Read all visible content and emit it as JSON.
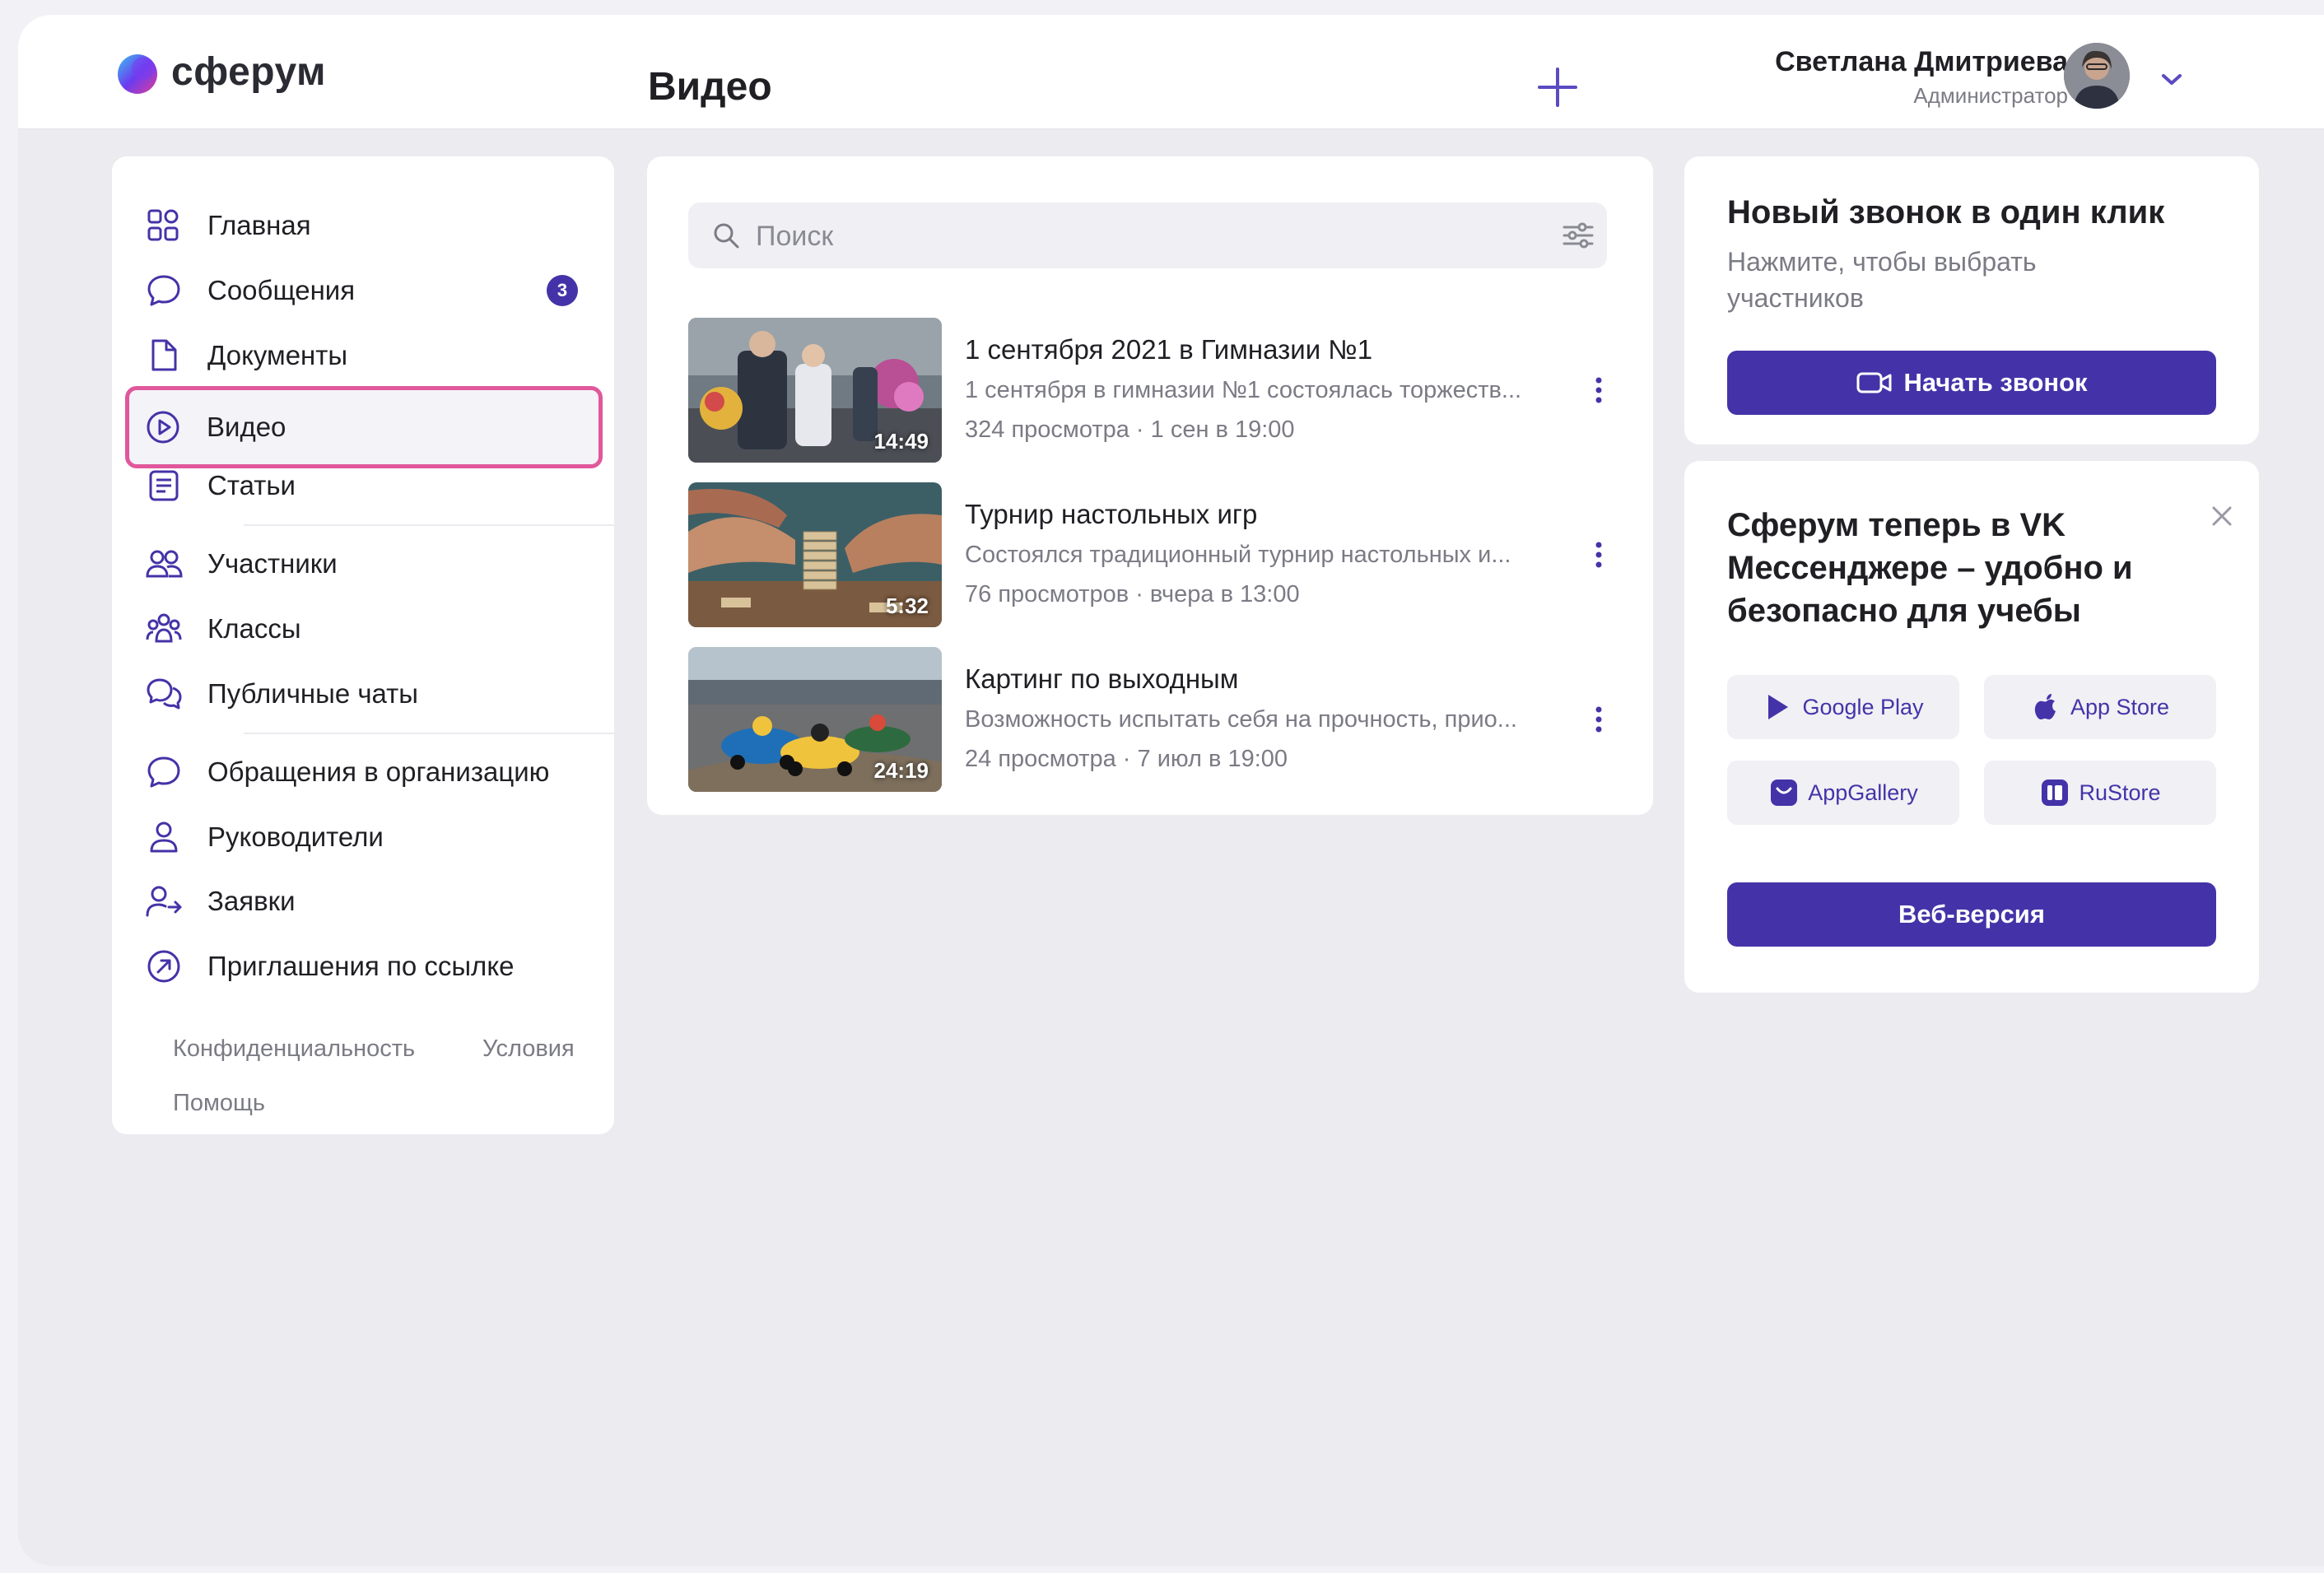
{
  "app": {
    "logo_text": "сферум",
    "page_title": "Видео"
  },
  "user": {
    "name": "Светлана Дмитриева",
    "role": "Администратор"
  },
  "sidebar": {
    "items": [
      {
        "label": "Главная"
      },
      {
        "label": "Сообщения",
        "badge": "3"
      },
      {
        "label": "Документы"
      },
      {
        "label": "Видео",
        "active": true
      },
      {
        "label": "Статьи"
      },
      {
        "label": "Участники"
      },
      {
        "label": "Классы"
      },
      {
        "label": "Публичные чаты"
      },
      {
        "label": "Обращения в организацию"
      },
      {
        "label": "Руководители"
      },
      {
        "label": "Заявки"
      },
      {
        "label": "Приглашения по ссылке"
      }
    ],
    "footer": {
      "privacy": "Конфиденциальность",
      "terms": "Условия",
      "help": "Помощь"
    }
  },
  "search": {
    "placeholder": "Поиск",
    "value": ""
  },
  "videos": [
    {
      "title": "1 сентября 2021 в Гимназии №1",
      "description": "1 сентября в гимназии №1 состоялась торжеств...",
      "meta": "324 просмотра · 1 сен в 19:00",
      "duration": "14:49"
    },
    {
      "title": "Турнир настольных игр",
      "description": "Состоялся традиционный турнир настольных и...",
      "meta": "76 просмотров · вчера в 13:00",
      "duration": "5:32"
    },
    {
      "title": "Картинг по выходным",
      "description": "Возможность испытать себя на прочность, прио...",
      "meta": "24 просмотра · 7 июл в 19:00",
      "duration": "24:19"
    }
  ],
  "call_card": {
    "title": "Новый звонок в один клик",
    "subtitle": "Нажмите, чтобы выбрать участников",
    "button": "Начать звонок"
  },
  "app_card": {
    "title": "Сферум теперь в VK Мессенджере – удобно и безопасно для учебы",
    "stores": [
      {
        "label": "Google Play",
        "icon": "google-play-icon"
      },
      {
        "label": "App Store",
        "icon": "apple-icon"
      },
      {
        "label": "AppGallery",
        "icon": "appgallery-icon"
      },
      {
        "label": "RuStore",
        "icon": "rustore-icon"
      }
    ],
    "web_button": "Веб-версия"
  },
  "colors": {
    "accent": "#4433a8",
    "active_outline": "#e0589b",
    "muted": "#7b7b85"
  }
}
